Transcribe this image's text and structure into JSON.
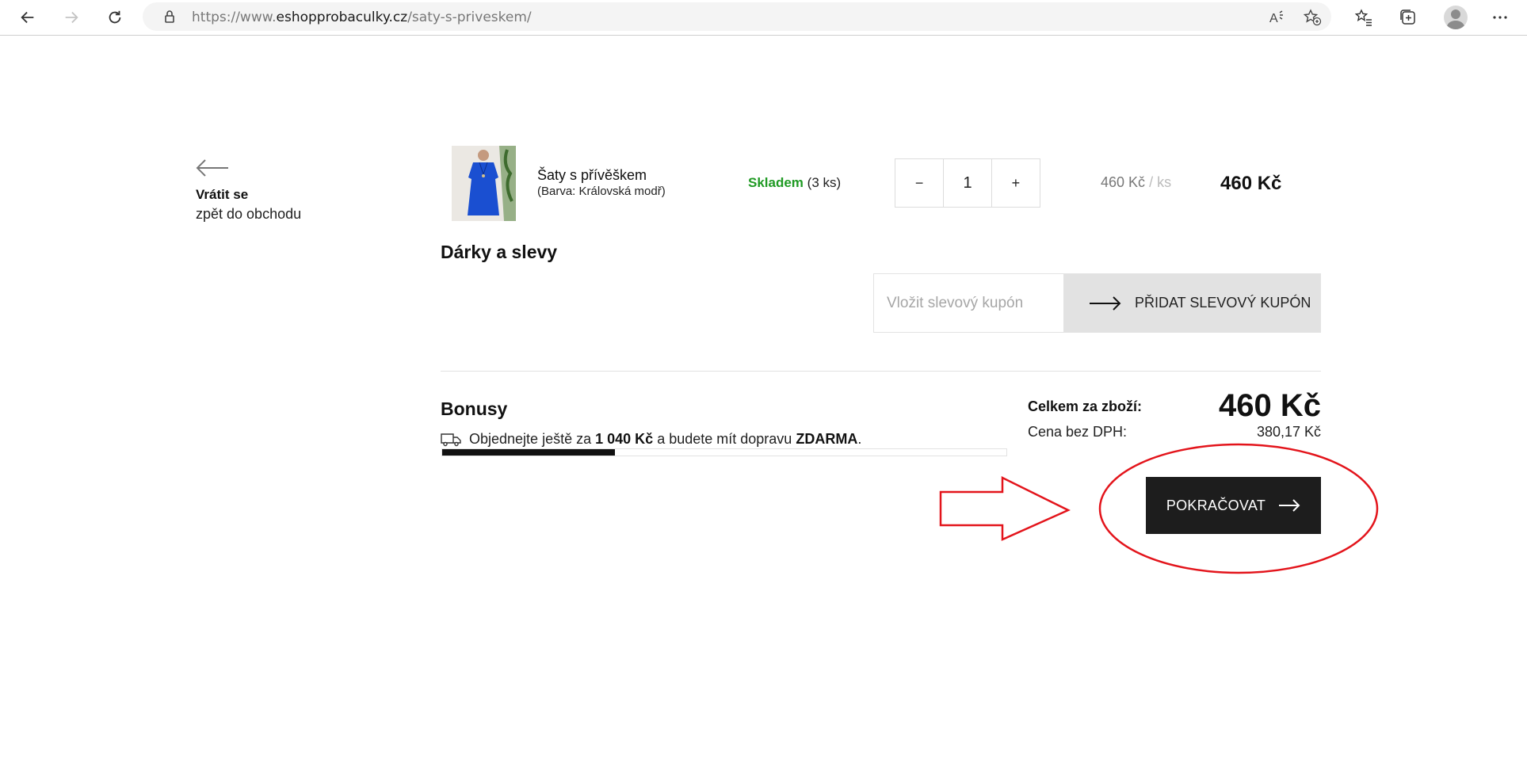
{
  "browser": {
    "url_prefix": "https://www.",
    "url_domain": "eshopprobaculky.cz",
    "url_path": "/saty-s-priveskem/"
  },
  "back": {
    "title": "Vrátit se",
    "subtitle": "zpět do obchodu"
  },
  "cart_item": {
    "name": "Šaty s přívěškem",
    "variant": "(Barva: Královská modř)",
    "stock_status": "Skladem",
    "stock_count": "(3 ks)",
    "minus_label": "−",
    "quantity": "1",
    "plus_label": "+",
    "unit_price": "460 Kč",
    "unit_sep": "/",
    "unit_unit": "ks",
    "line_total": "460 Kč",
    "thumb_color": "#1a4fd1"
  },
  "gifts": {
    "heading": "Dárky a slevy",
    "coupon_placeholder": "Vložit slevový kupón",
    "coupon_button": "PŘIDAT SLEVOVÝ KUPÓN"
  },
  "bonus": {
    "heading": "Bonusy",
    "text_before": "Objednejte ještě za",
    "amount": "1 040 Kč",
    "text_middle": "a budete mít dopravu",
    "free": "ZDARMA",
    "text_end": ".",
    "progress_fraction": 0.306
  },
  "totals": {
    "goods_label": "Celkem za zboží:",
    "goods_value": "460 Kč",
    "no_vat_label": "Cena bez DPH:",
    "no_vat_value": "380,17 Kč"
  },
  "continue_button": "POKRAČOVAT",
  "colors": {
    "in_stock": "#1f9a23",
    "button_dark": "#1d1d1d",
    "annotation_red": "#e3141b"
  }
}
